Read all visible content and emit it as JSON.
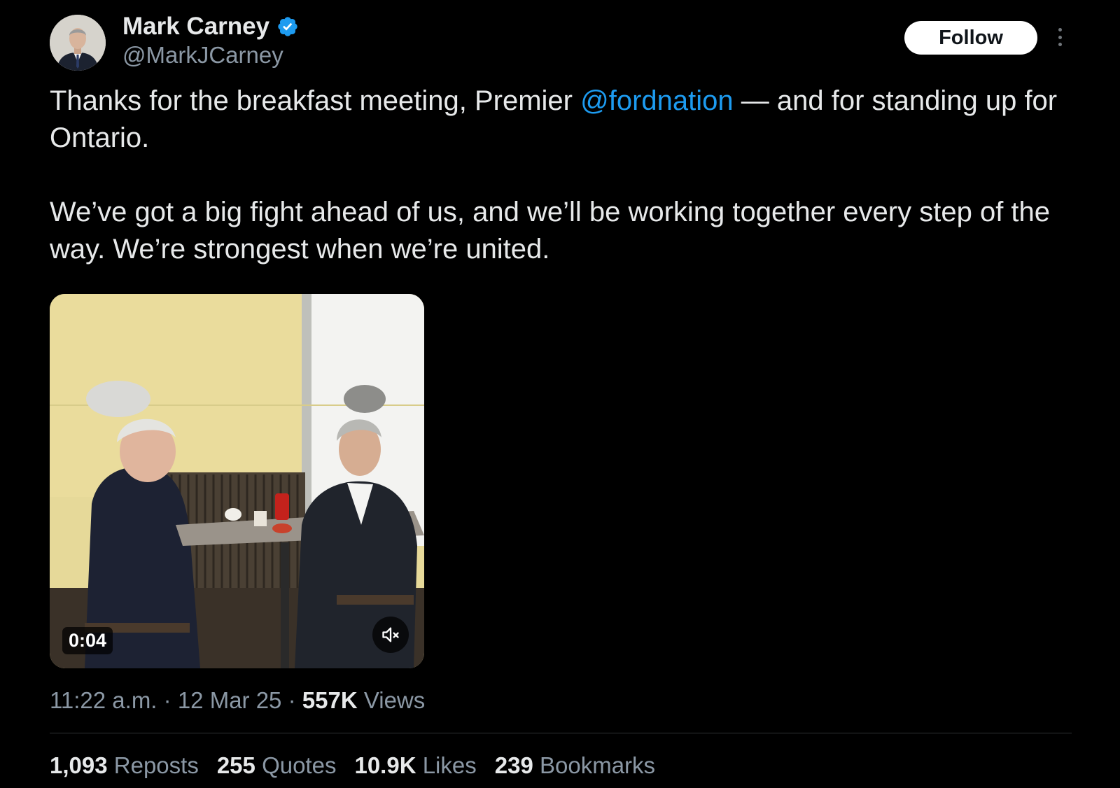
{
  "author": {
    "name": "Mark Carney",
    "handle": "@MarkJCarney",
    "verified": true,
    "verified_color": "#1d9bf0"
  },
  "actions": {
    "follow_label": "Follow",
    "more_icon": "more-vertical-icon"
  },
  "tweet": {
    "text_1_before": "Thanks for the breakfast meeting, Premier ",
    "mention": "@fordnation",
    "text_1_after": " — and for standing up for Ontario.",
    "text_2": "We’ve got a big fight ahead of us, and we’ll be working together every step of the way. We’re strongest when we’re united."
  },
  "media": {
    "type": "video",
    "duration": "0:04",
    "mute_icon": "speaker-muted-icon"
  },
  "meta": {
    "time": "11:22 a.m.",
    "separator": "·",
    "date": "12 Mar 25",
    "views_count": "557K",
    "views_label": "Views"
  },
  "stats": [
    {
      "count": "1,093",
      "label": "Reposts"
    },
    {
      "count": "255",
      "label": "Quotes"
    },
    {
      "count": "10.9K",
      "label": "Likes"
    },
    {
      "count": "239",
      "label": "Bookmarks"
    }
  ],
  "colors": {
    "background": "#000000",
    "text": "#e7e9ea",
    "secondary": "#8b98a5",
    "link": "#1d9bf0"
  }
}
